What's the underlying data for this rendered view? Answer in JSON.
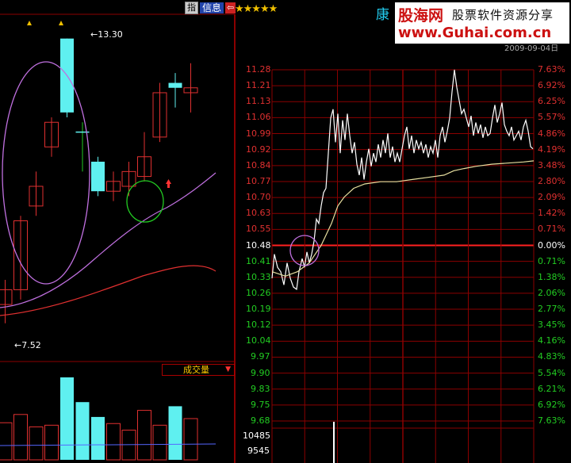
{
  "toolbar": {
    "zhi_icon": "指",
    "info_label": "信息",
    "exit_icon": "⇦",
    "stars": "★★★★★"
  },
  "stock_char": "康",
  "banner": {
    "logo": "股海网",
    "slogan": "股票软件资源分享",
    "url": "www.Guhai.com.cn"
  },
  "timestamp_partial": "2009-09-04日",
  "kline": {
    "high_marker": "←13.30",
    "low_marker": "←7.52",
    "volume_label": "成交量",
    "volume_arrow": "▼",
    "candles": [
      {
        "o": 7.9,
        "c": 8.2,
        "h": 8.4,
        "l": 7.52,
        "up": true
      },
      {
        "o": 8.2,
        "c": 9.6,
        "h": 9.7,
        "l": 8.0,
        "up": true
      },
      {
        "o": 9.9,
        "c": 10.3,
        "h": 10.6,
        "l": 9.7,
        "up": true
      },
      {
        "o": 11.1,
        "c": 11.6,
        "h": 11.7,
        "l": 10.9,
        "up": true
      },
      {
        "o": 11.8,
        "c": 13.3,
        "h": 13.3,
        "l": 11.7,
        "up": false,
        "cyan": true
      },
      {
        "o": 11.4,
        "c": 11.4,
        "h": 11.6,
        "l": 10.6,
        "up": false,
        "cross": true
      },
      {
        "o": 10.8,
        "c": 10.2,
        "h": 10.9,
        "l": 10.1,
        "up": false,
        "cyan": true
      },
      {
        "o": 10.2,
        "c": 10.4,
        "h": 10.6,
        "l": 10.0,
        "up": true
      },
      {
        "o": 10.3,
        "c": 10.6,
        "h": 10.8,
        "l": 10.1,
        "up": true
      },
      {
        "o": 10.5,
        "c": 10.9,
        "h": 11.4,
        "l": 10.4,
        "up": true
      },
      {
        "o": 11.3,
        "c": 12.2,
        "h": 12.4,
        "l": 11.2,
        "up": true
      },
      {
        "o": 12.4,
        "c": 12.3,
        "h": 12.6,
        "l": 11.9,
        "up": false,
        "cyan": true
      },
      {
        "o": 12.2,
        "c": 12.3,
        "h": 12.8,
        "l": 11.8,
        "up": true
      }
    ],
    "volumes": [
      0.45,
      0.55,
      0.4,
      0.42,
      1.0,
      0.7,
      0.52,
      0.44,
      0.36,
      0.6,
      0.42,
      0.65,
      0.5
    ]
  },
  "intraday": {
    "price_labels": [
      "11.28",
      "11.21",
      "11.13",
      "11.06",
      "10.99",
      "10.92",
      "10.84",
      "10.77",
      "10.70",
      "10.63",
      "10.55",
      "10.48",
      "10.41",
      "10.33",
      "10.26",
      "10.19",
      "10.12",
      "10.04",
      "9.97",
      "9.90",
      "9.83",
      "9.75",
      "9.68"
    ],
    "pct_labels": [
      "7.63%",
      "6.92%",
      "6.25%",
      "5.57%",
      "4.86%",
      "4.19%",
      "3.48%",
      "2.80%",
      "2.09%",
      "1.42%",
      "0.71%",
      "0.00%",
      "0.71%",
      "1.38%",
      "2.06%",
      "2.77%",
      "3.45%",
      "4.16%",
      "4.83%",
      "5.54%",
      "6.21%",
      "6.92%",
      "7.63%"
    ],
    "base_index": 11,
    "volume_labels": [
      "10485",
      "9545"
    ]
  },
  "colors": {
    "grid_red": "#8b0000",
    "rising": "#e03030",
    "falling": "#22cc22",
    "cyan": "#5ff0f0",
    "ma_purple": "#c070e0",
    "ma_red": "#e03030",
    "circle_green": "#22cc22",
    "avg_line": "#e8e0a0"
  }
}
